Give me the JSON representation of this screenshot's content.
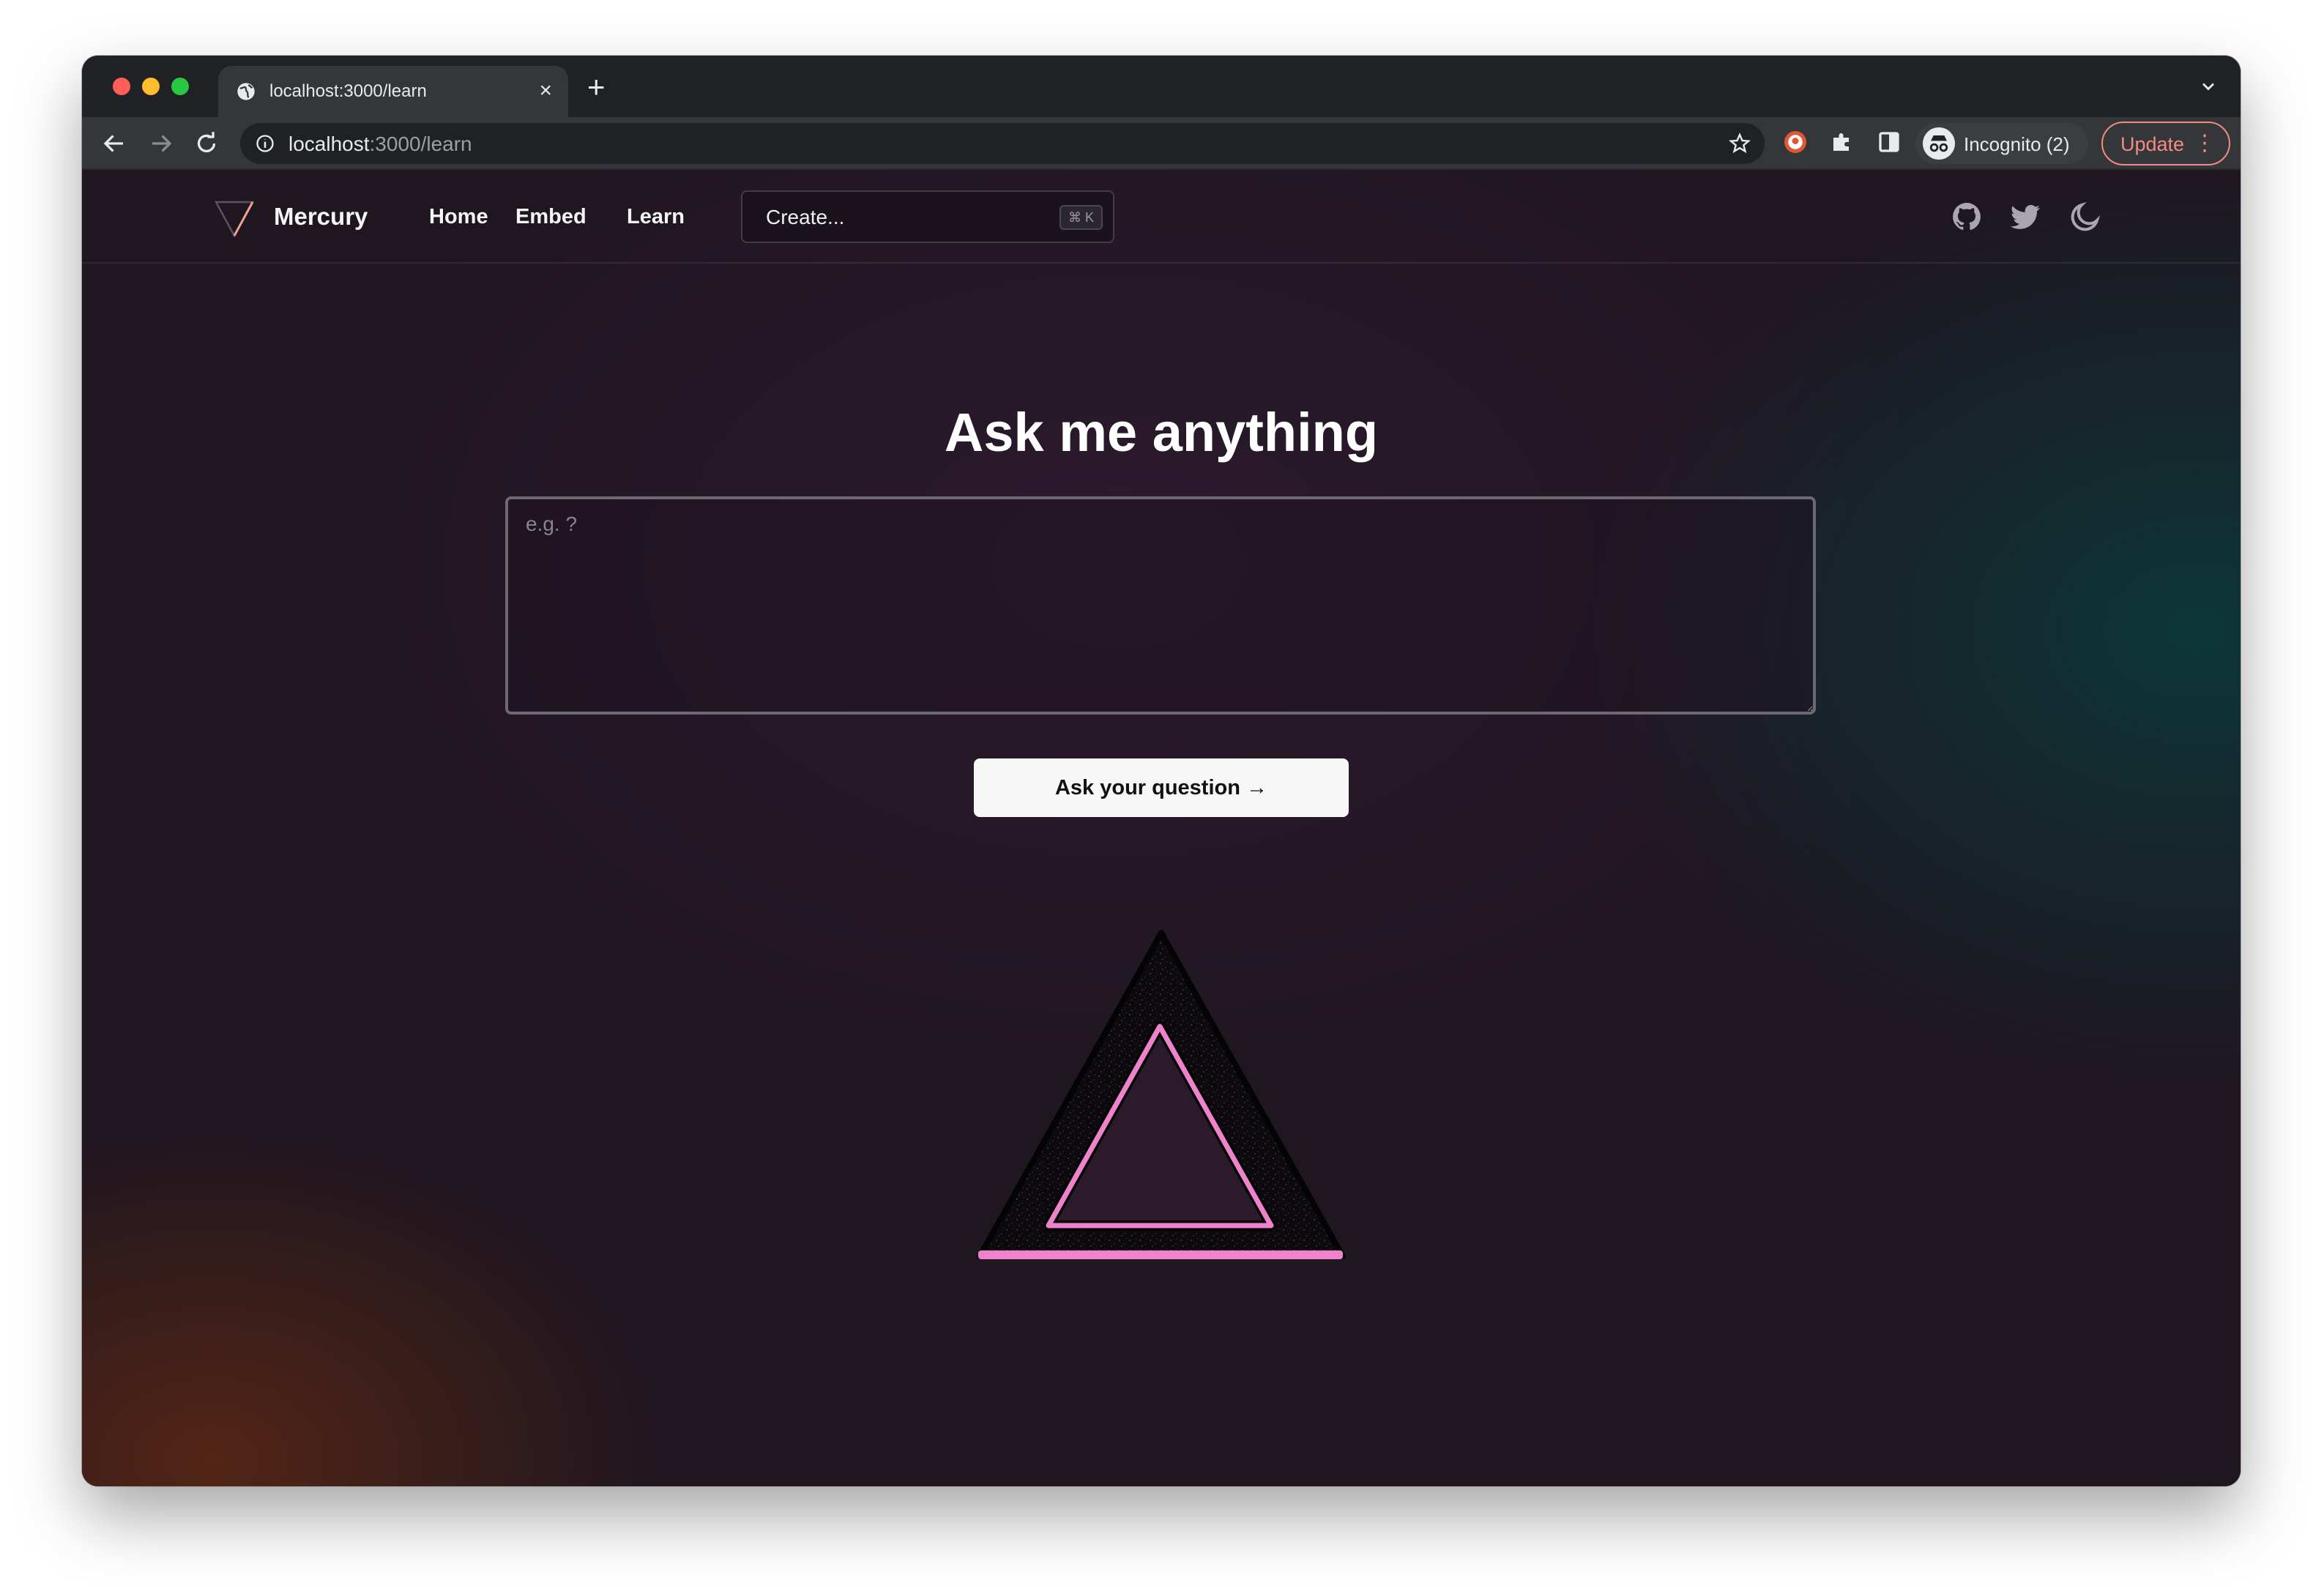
{
  "browser": {
    "tab_title": "localhost:3000/learn",
    "tab_close": "×",
    "new_tab": "+",
    "url_host": "localhost",
    "url_rest": ":3000/learn",
    "incognito_label": "Incognito (2)",
    "update_label": "Update",
    "update_menu": "⋮",
    "accent_update": "#f28b82"
  },
  "navbar": {
    "brand": "Mercury",
    "links": [
      "Home",
      "Embed",
      "Learn"
    ],
    "search_placeholder": "Create...",
    "search_shortcut": "⌘ K",
    "icons": [
      "github-icon",
      "twitter-icon",
      "moon-icon"
    ]
  },
  "main": {
    "title": "Ask me anything",
    "input_placeholder": "e.g. ?",
    "submit_label": "Ask your question →",
    "accent": "#ee82cc"
  }
}
